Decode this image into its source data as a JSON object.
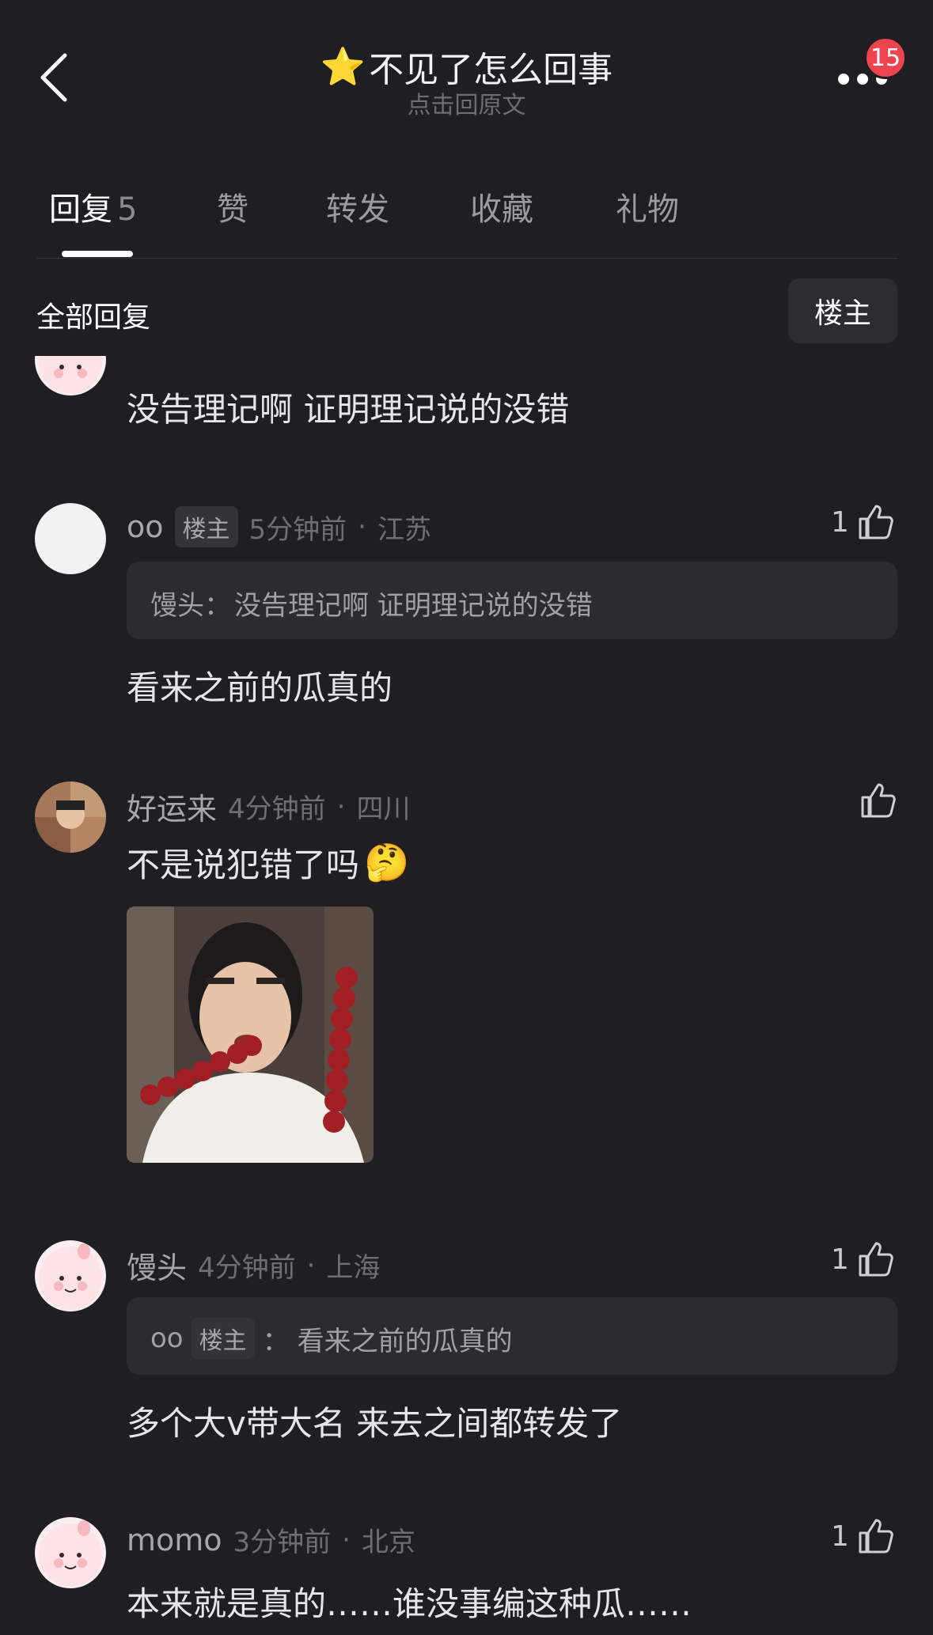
{
  "header": {
    "title_emoji": "⭐",
    "title": "不见了怎么回事",
    "subtitle": "点击回原文",
    "badge_count": "15"
  },
  "tabs": [
    {
      "label": "回复",
      "count": "5"
    },
    {
      "label": "赞"
    },
    {
      "label": "转发"
    },
    {
      "label": "收藏"
    },
    {
      "label": "礼物"
    }
  ],
  "section": {
    "title": "全部回复",
    "filter_label": "楼主"
  },
  "comments": [
    {
      "content": "没告理记啊 证明理记说的没错"
    },
    {
      "username": "oo",
      "tag": "楼主",
      "time": "5分钟前",
      "location": "江苏",
      "likes": "1",
      "quote_author": "馒头：",
      "quote_text": "没告理记啊 证明理记说的没错",
      "content": "看来之前的瓜真的"
    },
    {
      "username": "好运来",
      "time": "4分钟前",
      "location": "四川",
      "content": "不是说犯错了吗",
      "content_emoji": "🤔"
    },
    {
      "username": "馒头",
      "time": "4分钟前",
      "location": "上海",
      "likes": "1",
      "quote_author": "oo",
      "quote_tag": "楼主",
      "quote_sep": "：",
      "quote_text": "看来之前的瓜真的",
      "content": "多个大v带大名 来去之间都转发了"
    },
    {
      "username": "momo",
      "time": "3分钟前",
      "location": "北京",
      "likes": "1",
      "content": "本来就是真的……谁没事编这种瓜……"
    }
  ],
  "separator": "·",
  "colors": {
    "background": "#1f1f23",
    "badge": "#ee4450"
  }
}
